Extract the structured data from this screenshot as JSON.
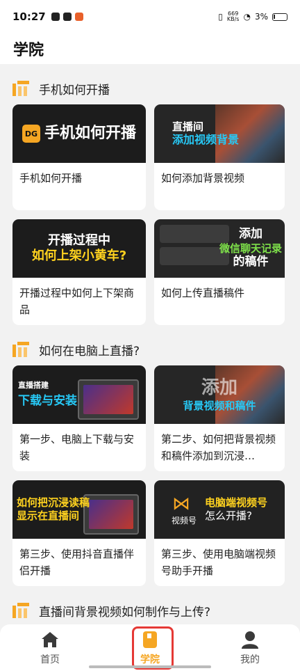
{
  "status_bar": {
    "time": "10:27",
    "speed": "669\nKB/s",
    "battery": "3%"
  },
  "page_title": "学院",
  "sections": [
    {
      "title": "手机如何开播",
      "cards": [
        {
          "thumb_lines": [
            "手机如何开播"
          ],
          "caption": "手机如何开播"
        },
        {
          "thumb_lines": [
            "直播间",
            "添加视频背景"
          ],
          "caption": "如何添加背景视频"
        },
        {
          "thumb_lines": [
            "开播过程中",
            "如何上架小黄车?"
          ],
          "caption": "开播过程中如何上下架商品"
        },
        {
          "thumb_lines": [
            "添加",
            "微信聊天记录",
            "的稿件"
          ],
          "caption": "如何上传直播稿件"
        }
      ]
    },
    {
      "title": "如何在电脑上直播?",
      "cards": [
        {
          "thumb_lines": [
            "直播搭建",
            "下载与安装"
          ],
          "caption": "第一步、电脑上下载与安装"
        },
        {
          "thumb_lines": [
            "添加",
            "背景视频和稿件"
          ],
          "caption": "第二步、如何把背景视频和稿件添加到沉浸…"
        },
        {
          "thumb_lines": [
            "如何把沉浸读稿",
            "显示在直播间"
          ],
          "caption": "第三步、使用抖音直播伴侣开播"
        },
        {
          "thumb_lines": [
            "视频号",
            "电脑端视频号",
            "怎么开播?"
          ],
          "caption": "第三步、使用电脑端视频号助手开播"
        }
      ]
    },
    {
      "title": "直播间背景视频如何制作与上传?"
    }
  ],
  "bottom_nav": [
    {
      "label": "首页",
      "icon": "home-icon"
    },
    {
      "label": "学院",
      "icon": "academy-icon",
      "active": true
    },
    {
      "label": "我的",
      "icon": "profile-icon"
    }
  ],
  "colors": {
    "accent": "#f5a623",
    "highlight": "#e53935"
  }
}
